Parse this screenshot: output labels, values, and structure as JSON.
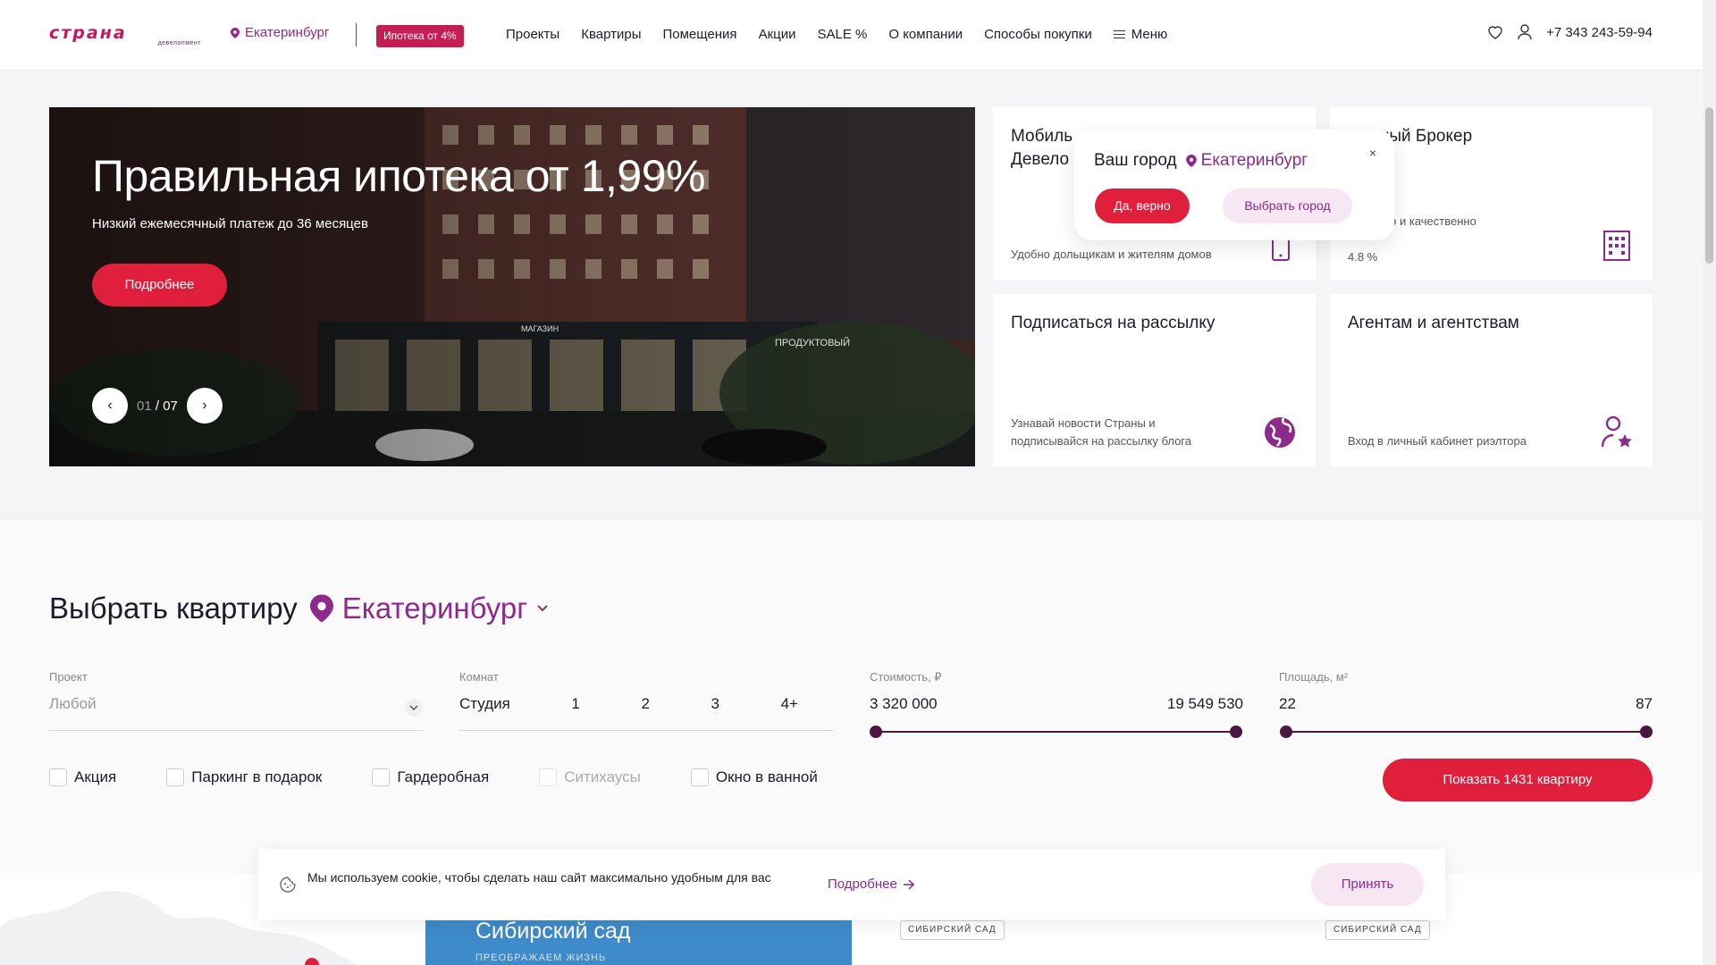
{
  "header": {
    "logo_text": "страна",
    "logo_sub": "девелопмент",
    "city": "Екатеринбург",
    "promo_badge": "Ипотека от 4%",
    "nav": [
      "Проекты",
      "Квартиры",
      "Помещения",
      "Акции",
      "SALE %",
      "О компании",
      "Способы покупки"
    ],
    "menu_label": "Меню",
    "phone": "+7 343 243-59-94"
  },
  "hero": {
    "title": "Правильная ипотека от 1,99%",
    "subtitle": "Низкий ежемесячный платеж до 36 месяцев",
    "button": "Подробнее",
    "slide_current": "01",
    "slide_separator": "/",
    "slide_total": "07",
    "shop_sign_1": "МАГАЗИН",
    "shop_sign_2": "ПРОДУКТОВЫЙ"
  },
  "cards": {
    "mobile": {
      "title_line1": "Мобиль",
      "title_line2": "Девело",
      "desc": "Удобно дольщикам и жителям домов"
    },
    "broker": {
      "title": "ечный Брокер",
      "desc_line1": "тно и качественно",
      "desc_line2": "4.8 %"
    },
    "subscribe": {
      "title": "Подписаться на рассылку",
      "desc_line1": "Узнавай новости Страны и",
      "desc_line2": "подписывайся на рассылку блога"
    },
    "agents": {
      "title": "Агентам и агентствам",
      "desc": "Вход в личный кабинет риэлтора"
    }
  },
  "city_popup": {
    "question": "Ваш город",
    "city": "Екатеринбург",
    "confirm": "Да, верно",
    "choose": "Выбрать город",
    "close": "×"
  },
  "filter": {
    "title": "Выбрать квартиру",
    "city": "Екатеринбург",
    "project_label": "Проект",
    "project_value": "Любой",
    "rooms_label": "Комнат",
    "rooms": [
      "Студия",
      "1",
      "2",
      "3",
      "4+"
    ],
    "price_label": "Стоимость, ₽",
    "price_min": "3 320 000",
    "price_max": "19 549 530",
    "area_label": "Площадь, м²",
    "area_min": "22",
    "area_max": "87",
    "checkboxes": [
      "Акция",
      "Паркинг в подарок",
      "Гардеробная",
      "Ситихаусы",
      "Окно в ванной"
    ],
    "show_button": "Показать 1431 квартиру"
  },
  "bottom": {
    "promo_title": "Сибирский сад",
    "promo_sub": "ПРЕОБРАЖАЕМ ЖИЗНЬ",
    "tag_1": "СИБИРСКИЙ САД",
    "tag_2": "СИБИРСКИЙ САД"
  },
  "cookie": {
    "text": "Мы используем cookie, чтобы сделать наш сайт максимально удобным для вас",
    "more": "Подробнее",
    "accept": "Принять"
  },
  "colors": {
    "accent_red": "#e01f3d",
    "brand_purple": "#8e2a8b",
    "logo_pink": "#c2185b"
  }
}
